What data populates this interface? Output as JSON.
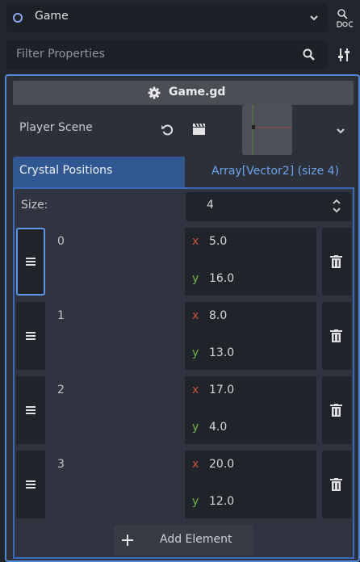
{
  "node": {
    "name": "Game",
    "doc_icon": "doc-icon"
  },
  "filter": {
    "placeholder": "Filter Properties"
  },
  "script": {
    "name": "Game.gd"
  },
  "player_scene": {
    "label": "Player Scene"
  },
  "crystal_positions": {
    "label": "Crystal Positions",
    "type": "Array[Vector2] (size 4)",
    "size_label": "Size:",
    "size_value": "4",
    "axis_labels": {
      "x": "x",
      "y": "y"
    },
    "elements": [
      {
        "index": "0",
        "x": "5.0",
        "y": "16.0"
      },
      {
        "index": "1",
        "x": "8.0",
        "y": "13.0"
      },
      {
        "index": "2",
        "x": "17.0",
        "y": "4.0"
      },
      {
        "index": "3",
        "x": "20.0",
        "y": "12.0"
      }
    ],
    "add_label": "Add Element"
  },
  "colors": {
    "accent": "#4e8ad8",
    "header_fill": "#2f5890",
    "axis_x": "#c9533f",
    "axis_y": "#75b34a"
  }
}
